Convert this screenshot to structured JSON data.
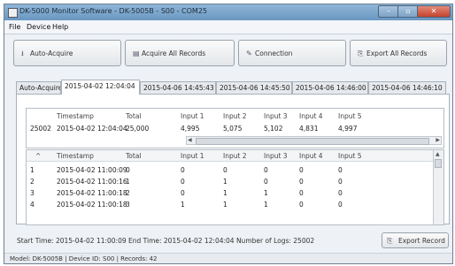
{
  "window": {
    "title": "DK-5000 Monitor Software - DK-5005B - S00 - COM25"
  },
  "menu": {
    "items": [
      "File",
      "Device",
      "Help"
    ]
  },
  "toolbar": {
    "auto_acquire": "Auto-Acquire",
    "acquire_all": "Acquire All Records",
    "connection": "Connection",
    "export_all": "Export All Records"
  },
  "tabs": [
    "Auto-Acquire",
    "2015-04-02 12:04:04",
    "2015-04-06 14:45:43",
    "2015-04-06 14:45:50",
    "2015-04-06 14:46:00",
    "2015-04-06 14:46:10"
  ],
  "summary": {
    "columns": [
      "",
      "Timestamp",
      "Total",
      "Input 1",
      "Input 2",
      "Input 3",
      "Input 4",
      "Input 5"
    ],
    "row": [
      "25002",
      "2015-04-02 12:04:04",
      "25,000",
      "4,995",
      "5,075",
      "5,102",
      "4,831",
      "4,997"
    ]
  },
  "records": {
    "columns": [
      "^",
      "Timestamp",
      "Total",
      "Input 1",
      "Input 2",
      "Input 3",
      "Input 4",
      "Input 5"
    ],
    "rows": [
      [
        "1",
        "2015-04-02 11:00:09",
        "0",
        "0",
        "0",
        "0",
        "0",
        "0"
      ],
      [
        "2",
        "2015-04-02 11:00:16",
        "1",
        "0",
        "1",
        "0",
        "0",
        "0"
      ],
      [
        "3",
        "2015-04-02 11:00:18",
        "2",
        "0",
        "1",
        "1",
        "0",
        "0"
      ],
      [
        "4",
        "2015-04-02 11:00:18",
        "3",
        "1",
        "1",
        "1",
        "0",
        "0"
      ]
    ]
  },
  "record_info": {
    "text": "Start Time: 2015-04-02 11:00:09  End Time: 2015-04-02 12:04:04  Number of Logs: 25002"
  },
  "export_record": "Export Record",
  "statusbar": {
    "text": "Model: DK-5005B | Device ID: S00 | Records: 42"
  }
}
